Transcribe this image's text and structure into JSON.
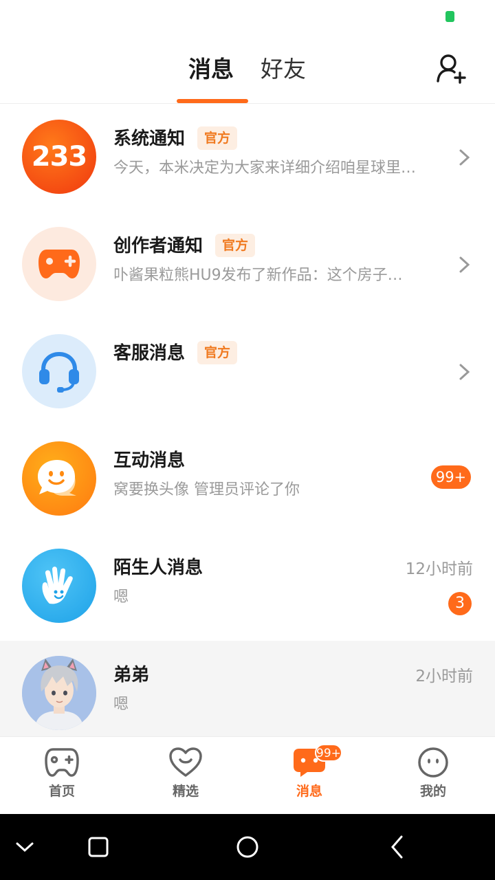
{
  "header": {
    "tab_messages": "消息",
    "tab_friends": "好友"
  },
  "messages": [
    {
      "title": "系统通知",
      "official": "官方",
      "preview": "今天，本米决定为大家来详细介绍咱星球里…",
      "icon": "233-logo-icon"
    },
    {
      "title": "创作者通知",
      "official": "官方",
      "preview": "卟酱果粒熊HU9发布了新作品：这个房子…",
      "icon": "gamepad-icon"
    },
    {
      "title": "客服消息",
      "official": "官方",
      "preview": "",
      "icon": "headset-icon"
    },
    {
      "title": "互动消息",
      "preview": "窝要换头像  管理员评论了你",
      "badge": "99+",
      "icon": "chat-bubble-icon"
    },
    {
      "title": "陌生人消息",
      "preview": "嗯",
      "time": "12小时前",
      "badge": "3",
      "icon": "waving-hand-icon"
    },
    {
      "title": "弟弟",
      "preview": "嗯",
      "time": "2小时前",
      "icon": "user-avatar"
    }
  ],
  "bottom_nav": {
    "items": [
      {
        "label": "首页",
        "icon": "gamepad-icon"
      },
      {
        "label": "精选",
        "icon": "heart-icon"
      },
      {
        "label": "消息",
        "icon": "message-icon",
        "active": true,
        "badge": "99+"
      },
      {
        "label": "我的",
        "icon": "face-icon"
      }
    ]
  },
  "colors": {
    "accent": "#ff6a1a",
    "official_bg": "#fdeee2",
    "official_text": "#f07a20",
    "status_green": "#22c55e"
  }
}
